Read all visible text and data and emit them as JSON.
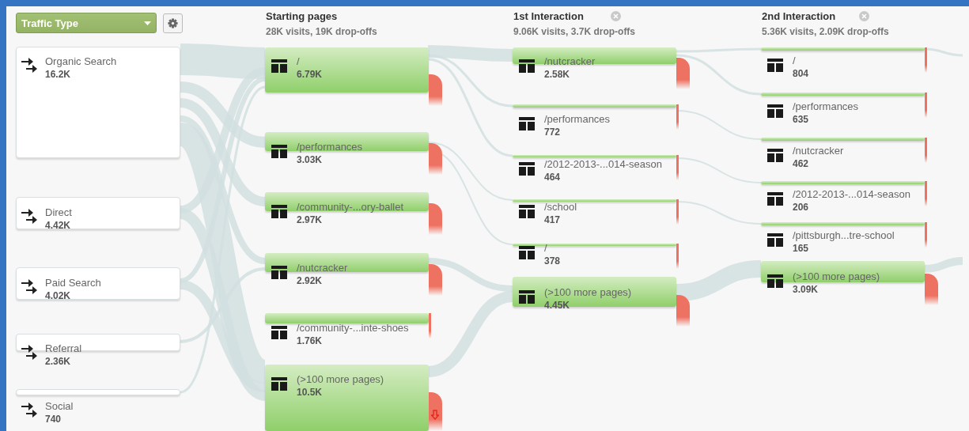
{
  "toolbar": {
    "dimension": "Traffic Type"
  },
  "columns": [
    {
      "kind": "sources",
      "nodes": [
        {
          "label": "Organic Search",
          "value": "16.2K"
        },
        {
          "label": "Direct",
          "value": "4.42K"
        },
        {
          "label": "Paid Search",
          "value": "4.02K"
        },
        {
          "label": "Referral",
          "value": "2.36K"
        },
        {
          "label": "Social",
          "value": "740"
        }
      ]
    },
    {
      "kind": "pages",
      "title": "Starting pages",
      "summary": "28K visits, 19K drop-offs",
      "closable": false,
      "nodes": [
        {
          "label": "/",
          "value": "6.79K"
        },
        {
          "label": "/performances",
          "value": "3.03K"
        },
        {
          "label": "/community-...ory-ballet",
          "value": "2.97K"
        },
        {
          "label": "/nutcracker",
          "value": "2.92K"
        },
        {
          "label": "/community-...inte-shoes",
          "value": "1.76K"
        },
        {
          "label": "(>100 more pages)",
          "value": "10.5K",
          "drop_arrow": true
        }
      ]
    },
    {
      "kind": "pages",
      "title": "1st Interaction",
      "summary": "9.06K visits, 3.7K drop-offs",
      "closable": true,
      "nodes": [
        {
          "label": "/nutcracker",
          "value": "2.58K"
        },
        {
          "label": "/performances",
          "value": "772"
        },
        {
          "label": "/2012-2013-...014-season",
          "value": "464"
        },
        {
          "label": "/school",
          "value": "417"
        },
        {
          "label": "/",
          "value": "378"
        },
        {
          "label": "(>100 more pages)",
          "value": "4.45K"
        }
      ]
    },
    {
      "kind": "pages",
      "title": "2nd Interaction",
      "summary": "5.36K visits, 2.09K drop-offs",
      "closable": true,
      "nodes": [
        {
          "label": "/",
          "value": "804"
        },
        {
          "label": "/performances",
          "value": "635"
        },
        {
          "label": "/nutcracker",
          "value": "462"
        },
        {
          "label": "/2012-2013-...014-season",
          "value": "206"
        },
        {
          "label": "/pittsburgh...tre-school",
          "value": "165"
        },
        {
          "label": "(>100 more pages)",
          "value": "3.09K"
        }
      ]
    }
  ]
}
